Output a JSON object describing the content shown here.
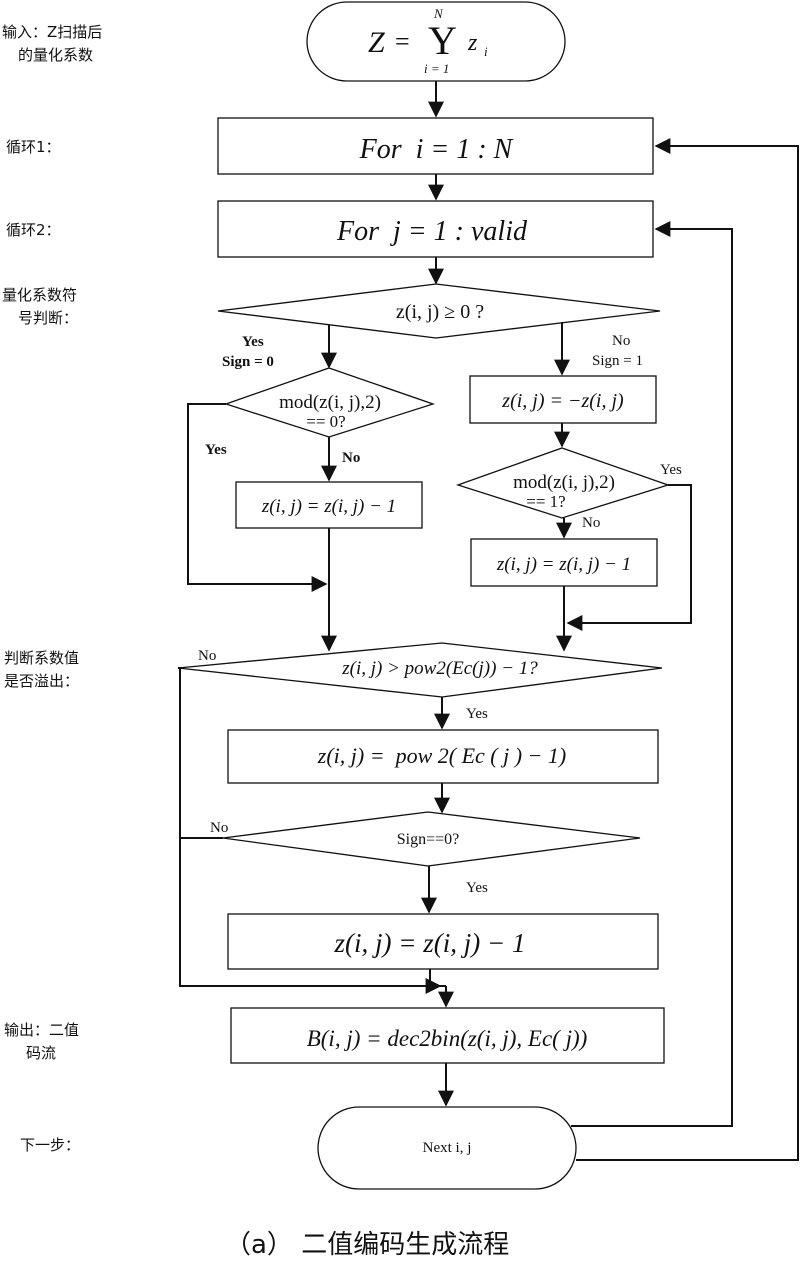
{
  "figure": {
    "caption": "（a） 二值编码生成流程",
    "side_labels": [
      {
        "id": "input",
        "lines": [
          "输入：Z扫描后",
          "的量化系数"
        ]
      },
      {
        "id": "loop1",
        "lines": [
          "循环1："
        ]
      },
      {
        "id": "loop2",
        "lines": [
          "循环2："
        ]
      },
      {
        "id": "sign_check",
        "lines": [
          "量化系数符",
          "号判断："
        ]
      },
      {
        "id": "overflow_check",
        "lines": [
          "判断系数值",
          "是否溢出："
        ]
      },
      {
        "id": "output",
        "lines": [
          "输出：二值",
          "码流"
        ]
      },
      {
        "id": "next",
        "lines": [
          "下一步："
        ]
      }
    ],
    "nodes": {
      "start": {
        "type": "terminator",
        "lhs": "Z",
        "eq": "=",
        "op": "Y",
        "upper": "N",
        "lower": "i = 1",
        "term": "z",
        "sub": "i"
      },
      "loop_i": {
        "type": "process",
        "text": "For  i = 1 : N"
      },
      "loop_j": {
        "type": "process",
        "text": "For  j = 1 : valid"
      },
      "sign_decision": {
        "type": "decision",
        "text": "z(i, j) ≥ 0 ?"
      },
      "mod0_decision": {
        "type": "decision",
        "lines": [
          "mod(z(i, j),2)",
          "== 0?"
        ]
      },
      "negate": {
        "type": "process",
        "text": "z(i, j) = −z(i, j)"
      },
      "decrement_left": {
        "type": "process",
        "text": "z(i, j) = z(i, j) − 1"
      },
      "mod1_decision": {
        "type": "decision",
        "lines": [
          "mod(z(i, j),2)",
          "== 1?"
        ]
      },
      "decrement_right": {
        "type": "process",
        "text": "z(i, j) = z(i, j) − 1"
      },
      "overflow_decision": {
        "type": "decision",
        "text": "z(i, j) > pow2(Ec(j)) − 1?"
      },
      "clamp": {
        "type": "process",
        "text": "z(i, j) =  pow 2( Ec ( j ) − 1)"
      },
      "sign0_decision": {
        "type": "decision",
        "text": "Sign==0?"
      },
      "decrement_final": {
        "type": "process",
        "text": "z(i, j) = z(i, j) − 1"
      },
      "output_bin": {
        "type": "process",
        "text": "B(i, j) = dec2bin(z(i, j), Ec( j))"
      },
      "next_ij": {
        "type": "terminator",
        "text": "Next i, j"
      }
    },
    "edge_labels": {
      "sign_yes": [
        "Yes",
        "Sign = 0"
      ],
      "sign_no": [
        "No",
        "Sign = 1"
      ],
      "mod0_yes": "Yes",
      "mod0_no": "No",
      "mod1_yes": "Yes",
      "mod1_no": "No",
      "overflow_no": "No",
      "overflow_yes": "Yes",
      "sign0_no": "No",
      "sign0_yes": "Yes"
    }
  }
}
